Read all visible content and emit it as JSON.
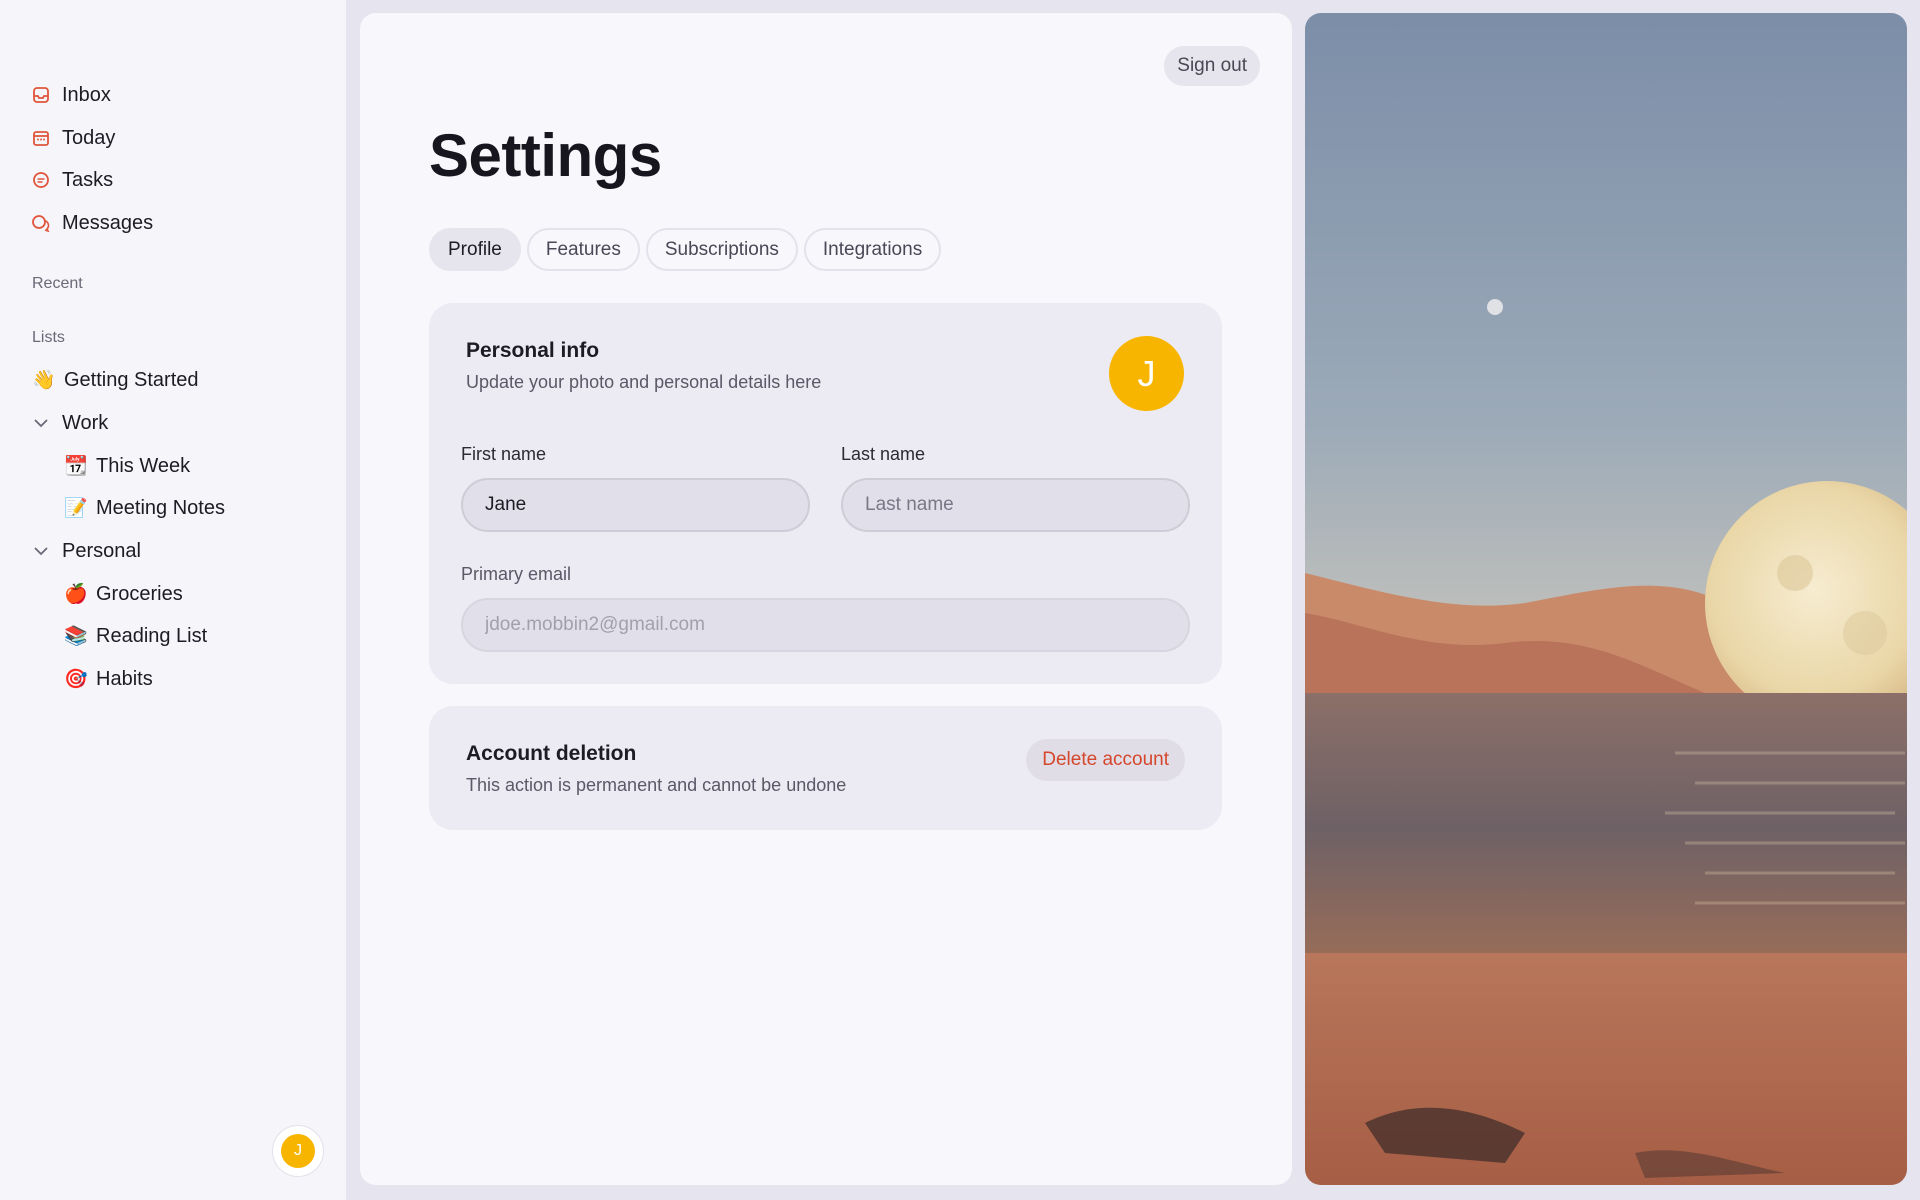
{
  "sidebar": {
    "nav": [
      {
        "label": "Inbox",
        "icon": "inbox-icon"
      },
      {
        "label": "Today",
        "icon": "calendar-icon"
      },
      {
        "label": "Tasks",
        "icon": "tasks-icon"
      },
      {
        "label": "Messages",
        "icon": "messages-icon"
      }
    ],
    "recent_label": "Recent",
    "lists_label": "Lists",
    "lists": {
      "getting_started": {
        "emoji": "👋",
        "label": "Getting Started"
      },
      "work": {
        "label": "Work"
      },
      "this_week": {
        "emoji": "📆",
        "label": "This Week"
      },
      "meeting_notes": {
        "emoji": "📝",
        "label": "Meeting Notes"
      },
      "personal": {
        "label": "Personal"
      },
      "groceries": {
        "emoji": "🍎",
        "label": "Groceries"
      },
      "reading_list": {
        "emoji": "📚",
        "label": "Reading List"
      },
      "habits": {
        "emoji": "🎯",
        "label": "Habits"
      }
    },
    "user_initial": "J"
  },
  "header": {
    "signout_label": "Sign out",
    "title": "Settings"
  },
  "tabs": [
    {
      "label": "Profile",
      "active": true
    },
    {
      "label": "Features",
      "active": false
    },
    {
      "label": "Subscriptions",
      "active": false
    },
    {
      "label": "Integrations",
      "active": false
    }
  ],
  "personal_info": {
    "title": "Personal info",
    "subtitle": "Update your photo and personal details here",
    "avatar_initial": "J",
    "first_name_label": "First name",
    "first_name_value": "Jane",
    "last_name_label": "Last name",
    "last_name_placeholder": "Last name",
    "email_label": "Primary email",
    "email_value": "jdoe.mobbin2@gmail.com"
  },
  "account_deletion": {
    "title": "Account deletion",
    "subtitle": "This action is permanent and cannot be undone",
    "button_label": "Delete account"
  },
  "colors": {
    "accent_icon": "#e0553b",
    "avatar": "#f8b500",
    "danger": "#d5472c"
  }
}
